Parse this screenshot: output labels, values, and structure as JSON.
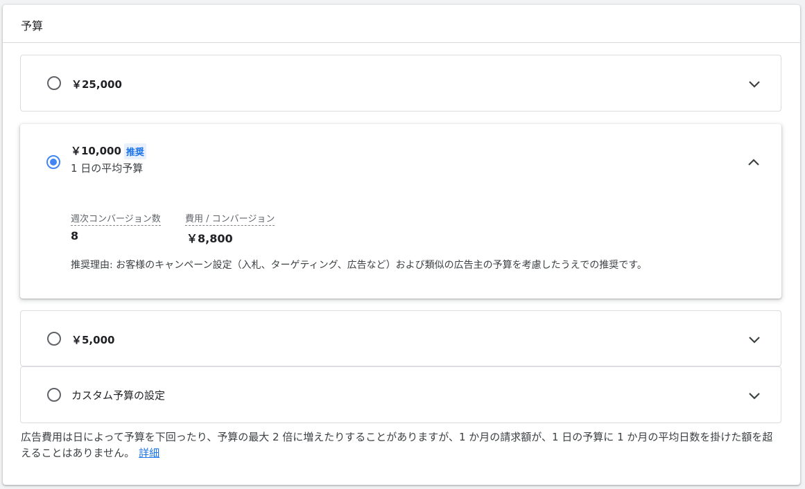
{
  "section": {
    "title": "予算"
  },
  "options": [
    {
      "amount": "￥25,000"
    },
    {
      "amount": "￥10,000",
      "badge": "推奨",
      "subtitle": "1 日の平均予算",
      "metrics": [
        {
          "label": "週次コンバージョン数",
          "value": "8"
        },
        {
          "label": "費用 / コンバージョン",
          "value": "￥8,800"
        }
      ],
      "reason": "推奨理由: お客様のキャンペーン設定（入札、ターゲティング、広告など）および類似の広告主の予算を考慮したうえでの推奨です。"
    },
    {
      "amount": "￥5,000"
    },
    {
      "amount": "カスタム予算の設定"
    }
  ],
  "selected": "￥10,000",
  "footer": {
    "text": "広告費用は日によって予算を下回ったり、予算の最大 2 倍に増えたりすることがありますが、1 か月の請求額が、1 日の予算に 1 か月の平均日数を掛けた額を超えることはありません。",
    "link": "詳細"
  },
  "colors": {
    "accent": "#4285f4",
    "link": "#1a73e8",
    "badge_bg": "#e8f0fe"
  },
  "icons": {
    "expand": "chevron-down-icon",
    "collapse": "chevron-up-icon"
  }
}
